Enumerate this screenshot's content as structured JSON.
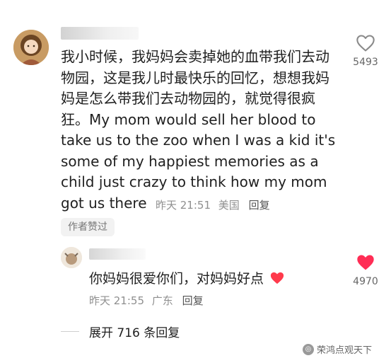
{
  "comment": {
    "body": "我小时候，我妈妈会卖掉她的血带我们去动物园，这是我儿时最快乐的回忆，想想我妈妈是怎么带我们去动物园的，就觉得很疯狂。My mom would sell her blood to take us to the zoo when I was a kid it's some of my happiest memories as a child just crazy to think how my mom got us there",
    "time": "昨天 21:51",
    "location": "美国",
    "reply_label": "回复",
    "author_liked_badge": "作者赞过",
    "like_count": "5493",
    "liked": false
  },
  "reply": {
    "body": "你妈妈很爱你们，对妈妈好点",
    "time": "昨天 21:55",
    "location": "广东",
    "reply_label": "回复",
    "like_count": "4970",
    "liked": true
  },
  "expand_label": "展开 716 条回复",
  "watermark": "荣鸿点观天下",
  "colors": {
    "like_active": "#ff2d55",
    "like_inactive": "#8a8a8a",
    "meta_text": "#8f8f8f"
  },
  "icons": {
    "like": "heart-outline-icon",
    "liked": "heart-filled-icon",
    "emoji": "red-heart-emoji"
  }
}
